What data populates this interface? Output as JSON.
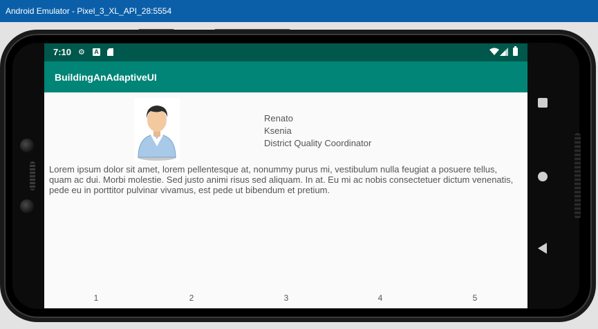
{
  "window": {
    "title": "Android Emulator - Pixel_3_XL_API_28:5554"
  },
  "status_bar": {
    "time": "7:10",
    "icons": [
      "settings-gear-icon",
      "a-notification-icon",
      "sd-card-icon",
      "wifi-icon",
      "signal-icon",
      "battery-icon"
    ]
  },
  "app_bar": {
    "title": "BuildingAnAdaptiveUI"
  },
  "profile": {
    "first_name": "Renato",
    "last_name": "Ksenia",
    "job_title": "District Quality Coordinator",
    "description": "Lorem ipsum dolor sit amet, lorem pellentesque at, nonummy purus mi, vestibulum nulla feugiat a posuere tellus, quam ac dui. Morbi molestie. Sed justo animi risus sed aliquam. In at. Eu mi ac nobis consectetuer dictum venenatis, pede eu in porttitor pulvinar vivamus, est pede ut bibendum et pretium."
  },
  "tabs": [
    "1",
    "2",
    "3",
    "4",
    "5"
  ],
  "nav_buttons": [
    "overview-square-icon",
    "home-circle-icon",
    "back-triangle-icon"
  ],
  "colors": {
    "title_bar": "#0a5fa8",
    "status_bar": "#00574b",
    "app_bar": "#008577",
    "screen_bg": "#fafafa",
    "text": "#555555"
  }
}
